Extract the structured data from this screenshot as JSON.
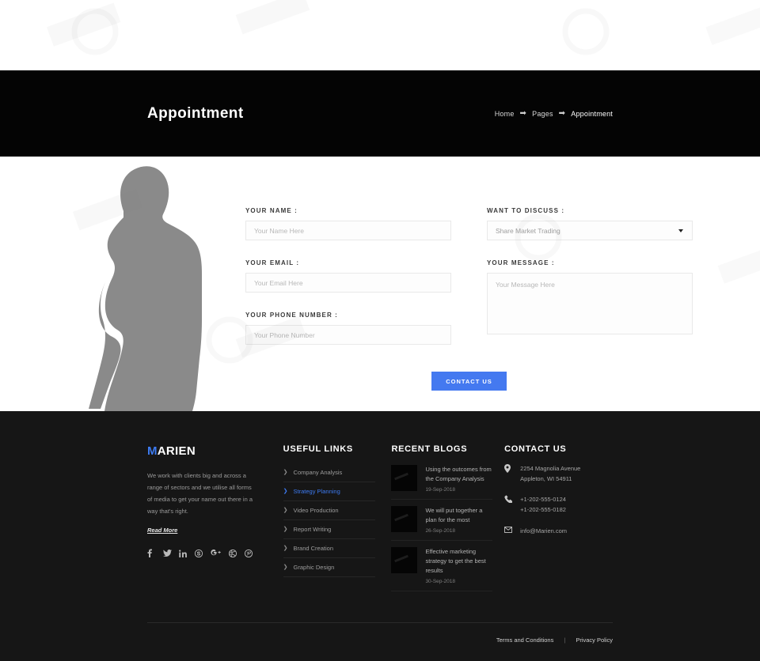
{
  "banner": {
    "title": "Appointment",
    "breadcrumb": [
      {
        "label": "Home",
        "current": false
      },
      {
        "label": "Pages",
        "current": false
      },
      {
        "label": "Appointment",
        "current": true
      }
    ],
    "separator": "➡"
  },
  "form": {
    "fields": {
      "name_label": "YOUR NAME :",
      "name_placeholder": "Your Name Here",
      "name_value": "",
      "email_label": "YOUR EMAIL :",
      "email_placeholder": "Your Email Here",
      "email_value": "",
      "phone_label": "YOUR PHONE NUMBER :",
      "phone_placeholder": "Your Phone Number",
      "phone_value": "",
      "discuss_label": "WANT TO DISCUSS :",
      "discuss_selected": "Share Market Trading",
      "discuss_options": [
        "Share Market Trading"
      ],
      "message_label": "YOUR MESSAGE :",
      "message_placeholder": "Your Message Here",
      "message_value": ""
    },
    "submit_label": "CONTACT US",
    "accent_color": "#4479f0"
  },
  "footer": {
    "brand": {
      "logo_accent": "M",
      "logo_rest": "ARIEN",
      "accent_color": "#3d7bf2",
      "description": "We work with clients big and across a range of sectors and we utilise all forms of media to get your name out there in a way that's right.",
      "read_more": "Read More",
      "socials": [
        {
          "name": "facebook-icon",
          "glyph": "f"
        },
        {
          "name": "twitter-icon",
          "glyph": "t"
        },
        {
          "name": "linkedin-icon",
          "glyph": "in"
        },
        {
          "name": "skype-icon",
          "glyph": "s"
        },
        {
          "name": "google-plus-icon",
          "glyph": "G+"
        },
        {
          "name": "dribbble-icon",
          "glyph": "d"
        },
        {
          "name": "pinterest-icon",
          "glyph": "p"
        }
      ]
    },
    "useful_links": {
      "title": "USEFUL LINKS",
      "items": [
        {
          "label": "Company Analysis",
          "active": false
        },
        {
          "label": "Strategy Planning",
          "active": true
        },
        {
          "label": "Video Production",
          "active": false
        },
        {
          "label": "Report Writing",
          "active": false
        },
        {
          "label": "Brand Creation",
          "active": false
        },
        {
          "label": "Graphic Design",
          "active": false
        }
      ]
    },
    "recent_blogs": {
      "title": "RECENT BLOGS",
      "items": [
        {
          "title": "Using the outcomes from the Company Analysis",
          "date": "19-Sep-2018"
        },
        {
          "title": "We will put together a plan for the most",
          "date": "26-Sep-2018"
        },
        {
          "title": "Effective marketing strategy to get the best results",
          "date": "30-Sep-2018"
        }
      ]
    },
    "contact": {
      "title": "CONTACT US",
      "address": "2254 Magnolia Avenue Appleton, WI 54911",
      "address_line1": "2254 Magnolia Avenue",
      "address_line2": "Appleton, WI 54911",
      "phone1": "+1-202-555-0124",
      "phone2": "+1-202-555-0182",
      "email": "info@Marien.com"
    },
    "bottom": {
      "terms": "Terms and Conditions",
      "divider": "|",
      "privacy": "Privacy Policy"
    }
  }
}
